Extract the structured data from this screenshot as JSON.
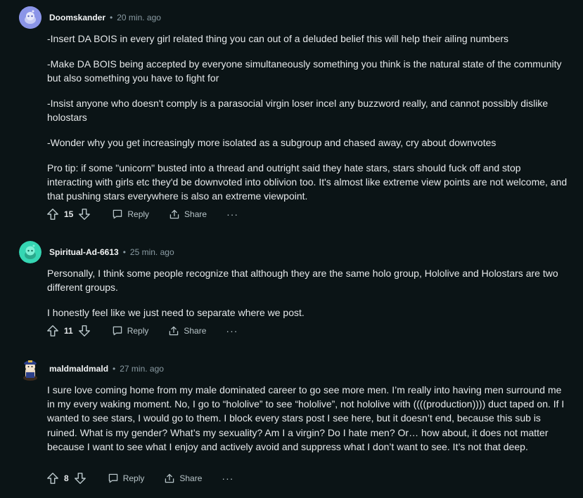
{
  "comments": [
    {
      "username": "Doomskander",
      "time": "20 min. ago",
      "avatar": "snoo-avatar-lavender",
      "paragraphs": [
        "-Insert DA BOIS in every girl related thing you can out of a deluded belief this will help their ailing numbers",
        "-Make DA BOIS being accepted by everyone simultaneously something you think is the natural state of the community but also something you have to fight for",
        "-Insist anyone who doesn't comply is a parasocial virgin loser incel any buzzword really, and cannot possibly dislike holostars",
        "-Wonder why you get increasingly more isolated as a subgroup and chased away, cry about downvotes",
        "Pro tip: if some \"unicorn\" busted into a thread and outright said they hate stars, stars should fuck off and stop interacting with girls etc they'd be downvoted into oblivion too. It's almost like extreme view points are not welcome, and that pushing stars everywhere is also an extreme viewpoint."
      ],
      "score": "15",
      "reply_label": "Reply",
      "share_label": "Share",
      "more_label": "···"
    },
    {
      "username": "Spiritual-Ad-6613",
      "time": "25 min. ago",
      "avatar": "snoo-avatar-teal",
      "paragraphs": [
        "Personally, I think some people recognize that although they are the same holo group, Hololive and Holostars are two different groups.",
        "I honestly feel like we just need to separate where we post."
      ],
      "score": "11",
      "reply_label": "Reply",
      "share_label": "Share",
      "more_label": "···"
    },
    {
      "username": "maldmaldmald",
      "time": "27 min. ago",
      "avatar": "custom-avatar-officer",
      "paragraphs": [
        "I sure love coming home from my male dominated career to go see more men. I’m really into having men surround me in my every waking moment. No, I go to “hololive” to see “hololive”, not hololive with ((((production)))) duct taped on. If I wanted to see stars, I would go to them. I block every stars post I see here, but it doesn’t end, because this sub is ruined. What is my gender? What’s my sexuality? Am I a virgin? Do I hate men? Or… how about, it does not matter because I want to see what I enjoy and actively avoid and suppress what I don’t want to see. It’s not that deep."
      ],
      "score": "8",
      "reply_label": "Reply",
      "share_label": "Share",
      "more_label": "···"
    }
  ],
  "dot": "•",
  "colors": {
    "background": "#0b1416",
    "text": "#e5e8ea",
    "muted": "#8a9ba3",
    "avatar1": "#8b95e8",
    "avatar2": "#35d6b3"
  }
}
